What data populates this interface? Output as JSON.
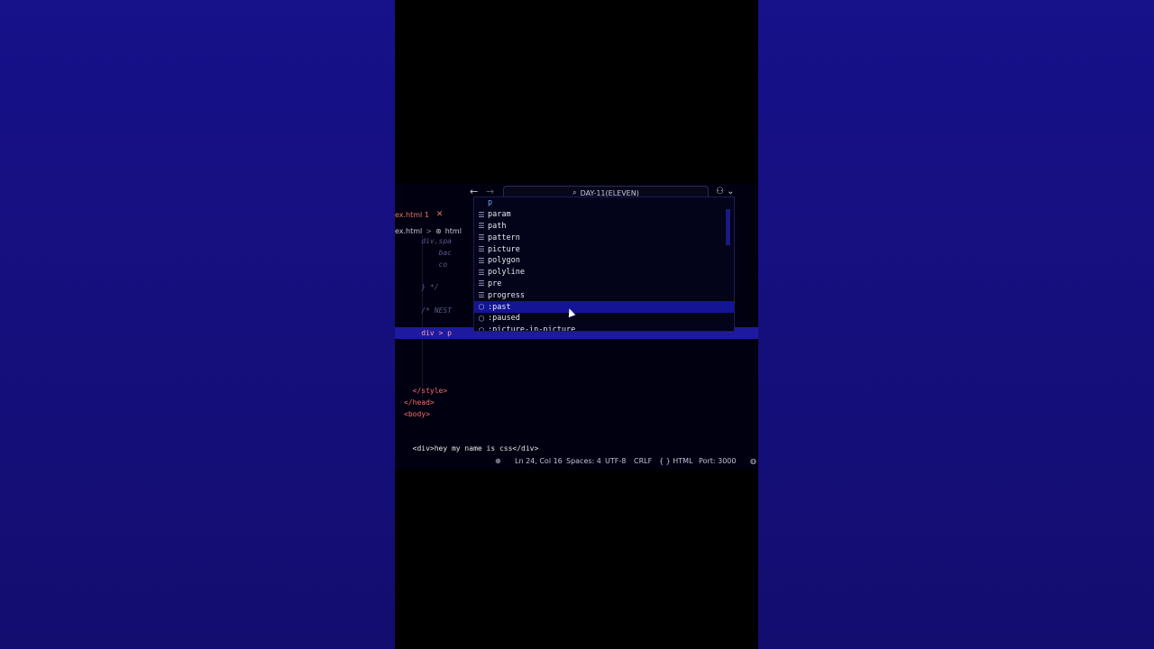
{
  "titlebar": {
    "back_icon": "←",
    "forward_icon": "→",
    "search_text": "DAY-11(ELEVEN)",
    "copilot_icon": "⚇ ⌄"
  },
  "tab": {
    "label": "ex.html 1",
    "close": "✕"
  },
  "breadcrumb": {
    "file": "ex.html",
    "sep": ">",
    "html": "html"
  },
  "code_lines": [
    {
      "text": "    div,spa",
      "type": "comment"
    },
    {
      "text": "        bac",
      "type": "comment"
    },
    {
      "text": "        co",
      "type": "comment"
    },
    {
      "text": "",
      "type": "plain"
    },
    {
      "text": "    } */",
      "type": "comment"
    },
    {
      "text": "",
      "type": "plain"
    },
    {
      "text": "    /* NEST",
      "type": "comment"
    },
    {
      "text": "",
      "type": "plain"
    },
    {
      "text": "    div > p",
      "type": "selector"
    },
    {
      "text": "",
      "type": "plain"
    },
    {
      "text": "",
      "type": "plain"
    },
    {
      "text": "",
      "type": "plain"
    },
    {
      "text": "",
      "type": "plain"
    },
    {
      "text": "  </style>",
      "type": "tag"
    },
    {
      "text": "</head>",
      "type": "tag"
    },
    {
      "text": "<body>",
      "type": "tag"
    },
    {
      "text": "",
      "type": "plain"
    },
    {
      "text": "",
      "type": "plain"
    },
    {
      "text": "  <div>hey my name is css</div>",
      "type": "tagtext"
    }
  ],
  "suggestions": [
    {
      "icon": "",
      "label": "p"
    },
    {
      "icon": "☰",
      "label": "param"
    },
    {
      "icon": "☰",
      "label": "path"
    },
    {
      "icon": "☰",
      "label": "pattern"
    },
    {
      "icon": "☰",
      "label": "picture"
    },
    {
      "icon": "☰",
      "label": "polygon"
    },
    {
      "icon": "☰",
      "label": "polyline"
    },
    {
      "icon": "☰",
      "label": "pre"
    },
    {
      "icon": "☰",
      "label": "progress"
    },
    {
      "icon": "⬡",
      "label": ":past"
    },
    {
      "icon": "⬡",
      "label": ":paused"
    },
    {
      "icon": "⬡",
      "label": ":picture-in-picture"
    }
  ],
  "selected_suggestion_index": 9,
  "statusbar": {
    "zoom_icon": "⊕",
    "position": "Ln 24, Col 16",
    "spaces": "Spaces: 4",
    "encoding": "UTF-8",
    "eol": "CRLF",
    "language": "{ } HTML",
    "port": "Port: 3000",
    "bell_icon": "◍"
  }
}
